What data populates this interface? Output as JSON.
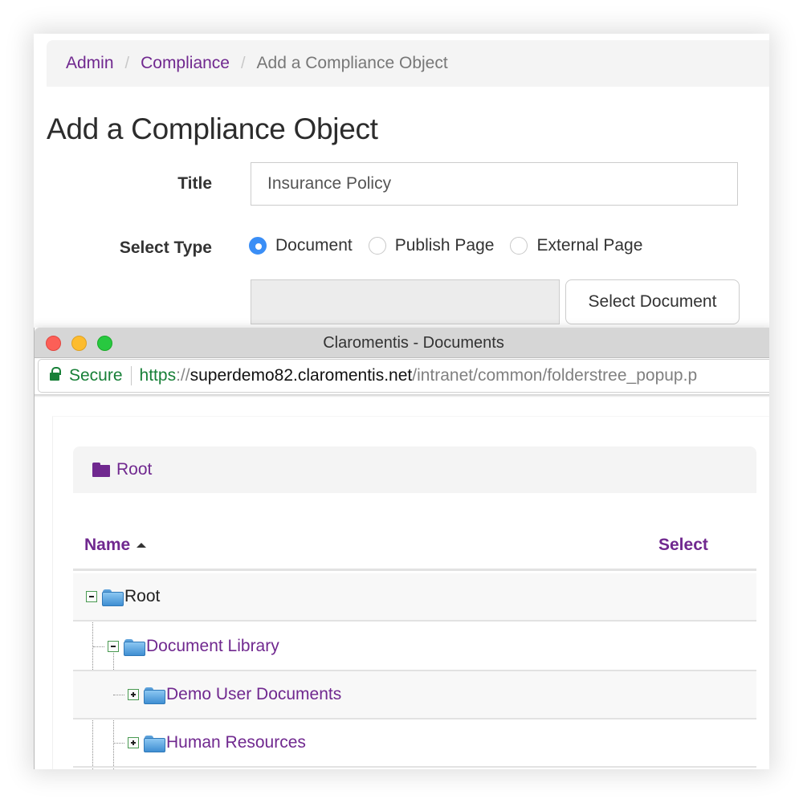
{
  "breadcrumb": {
    "items": [
      "Admin",
      "Compliance"
    ],
    "separator": "/",
    "current": "Add a Compliance Object"
  },
  "page": {
    "title": "Add a Compliance Object"
  },
  "form": {
    "title_label": "Title",
    "title_value": "Insurance Policy",
    "type_label": "Select Type",
    "type_options": [
      "Document",
      "Publish Page",
      "External Page"
    ],
    "type_selected": "Document",
    "document_value": "",
    "select_document_label": "Select Document"
  },
  "popup": {
    "window_title": "Claromentis - Documents",
    "address": {
      "secure_label": "Secure",
      "scheme": "https",
      "slashes": "://",
      "host": "superdemo82.claromentis.net",
      "path": "/intranet/common/folderstree_popup.p"
    },
    "root_bar_label": "Root",
    "table": {
      "columns": [
        "Name",
        "Select"
      ],
      "sort": "ascending",
      "rows": [
        {
          "label": "Root",
          "level": 0,
          "expanded": true
        },
        {
          "label": "Document Library",
          "level": 1,
          "expanded": true
        },
        {
          "label": "Demo User Documents",
          "level": 2,
          "expanded": false
        },
        {
          "label": "Human Resources",
          "level": 2,
          "expanded": false
        }
      ]
    }
  },
  "colors": {
    "link_purple": "#70288f",
    "radio_blue": "#3a8ef6",
    "secure_green": "#188038"
  }
}
